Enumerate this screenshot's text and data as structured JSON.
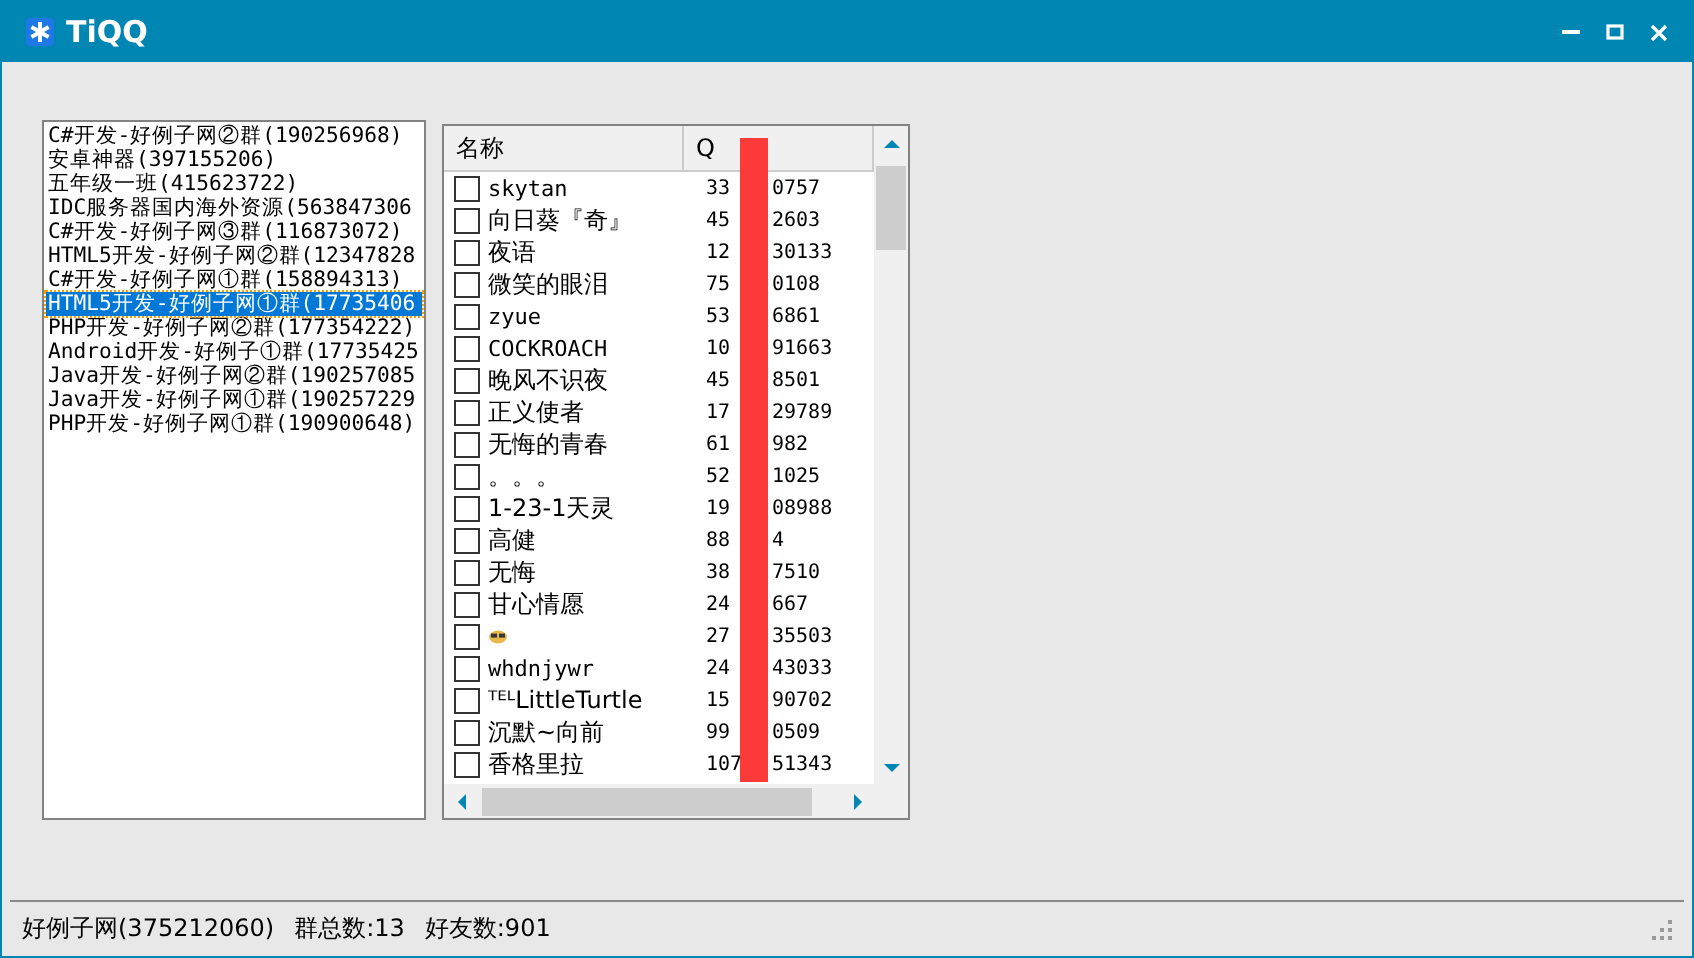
{
  "window": {
    "title": "TiQQ"
  },
  "groups": [
    {
      "label": "C#开发-好例子网②群(190256968)",
      "selected": false
    },
    {
      "label": "安卓神器(397155206)",
      "selected": false
    },
    {
      "label": "五年级一班(415623722)",
      "selected": false
    },
    {
      "label": "IDC服务器国内海外资源(563847306",
      "selected": false
    },
    {
      "label": "C#开发-好例子网③群(116873072)",
      "selected": false
    },
    {
      "label": "HTML5开发-好例子网②群(12347828",
      "selected": false
    },
    {
      "label": "C#开发-好例子网①群(158894313)",
      "selected": false
    },
    {
      "label": "HTML5开发-好例子网①群(17735406",
      "selected": true
    },
    {
      "label": "PHP开发-好例子网②群(177354222)",
      "selected": false
    },
    {
      "label": "Android开发-好例子①群(17735425",
      "selected": false
    },
    {
      "label": "Java开发-好例子网②群(190257085",
      "selected": false
    },
    {
      "label": "Java开发-好例子网①群(190257229",
      "selected": false
    },
    {
      "label": "PHP开发-好例子网①群(190900648)",
      "selected": false
    }
  ],
  "friends": {
    "columns": [
      "名称",
      "Q"
    ],
    "rows": [
      {
        "kind": "text",
        "name": "skytan",
        "qq_start": "33",
        "qq_end": "0757",
        "checked": false
      },
      {
        "kind": "text",
        "name": "向日葵『奇』",
        "qq_start": "45",
        "qq_end": "2603",
        "checked": false
      },
      {
        "kind": "text",
        "name": "夜语",
        "qq_start": "12",
        "qq_end": "30133",
        "checked": false
      },
      {
        "kind": "text",
        "name": "微笑的眼泪",
        "qq_start": "75",
        "qq_end": "0108",
        "checked": false
      },
      {
        "kind": "text",
        "name": "zyue",
        "qq_start": "53",
        "qq_end": "6861",
        "checked": false
      },
      {
        "kind": "text",
        "name": "COCKROACH",
        "qq_start": "10",
        "qq_end": "91663",
        "checked": false
      },
      {
        "kind": "text",
        "name": "晚风不识夜",
        "qq_start": "45",
        "qq_end": "8501",
        "checked": false
      },
      {
        "kind": "text",
        "name": "正义使者",
        "qq_start": "17",
        "qq_end": "29789",
        "checked": false
      },
      {
        "kind": "text",
        "name": "无悔的青春",
        "qq_start": "61",
        "qq_end": "982",
        "checked": false
      },
      {
        "kind": "text",
        "name": "。。。",
        "qq_start": "52",
        "qq_end": "1025",
        "checked": false
      },
      {
        "kind": "text",
        "name": "1-23-1天灵",
        "qq_start": "19",
        "qq_end": "08988",
        "checked": false
      },
      {
        "kind": "text",
        "name": "高健",
        "qq_start": "88",
        "qq_end": "4",
        "checked": false
      },
      {
        "kind": "text",
        "name": "无悔",
        "qq_start": "38",
        "qq_end": "7510",
        "checked": false
      },
      {
        "kind": "text",
        "name": "甘心情愿",
        "qq_start": "24",
        "qq_end": "667",
        "checked": false
      },
      {
        "kind": "emoji",
        "qq_start": "27",
        "qq_end": "35503",
        "checked": false
      },
      {
        "kind": "text",
        "name": "whdnjywr",
        "qq_start": "24",
        "qq_end": "43033",
        "checked": false
      },
      {
        "kind": "text",
        "name": "ᵀᴱᴸLittleTurtle",
        "qq_start": "15",
        "qq_end": "90702",
        "checked": false
      },
      {
        "kind": "text",
        "name": "沉默~向前",
        "qq_start": "99",
        "qq_end": "0509",
        "checked": false
      },
      {
        "kind": "text",
        "name": "香格里拉",
        "qq_start": "107",
        "qq_end": "51343",
        "checked": false
      }
    ]
  },
  "status_bar": [
    "好例子网(375212060)",
    "群总数:13",
    "好友数:901"
  ]
}
